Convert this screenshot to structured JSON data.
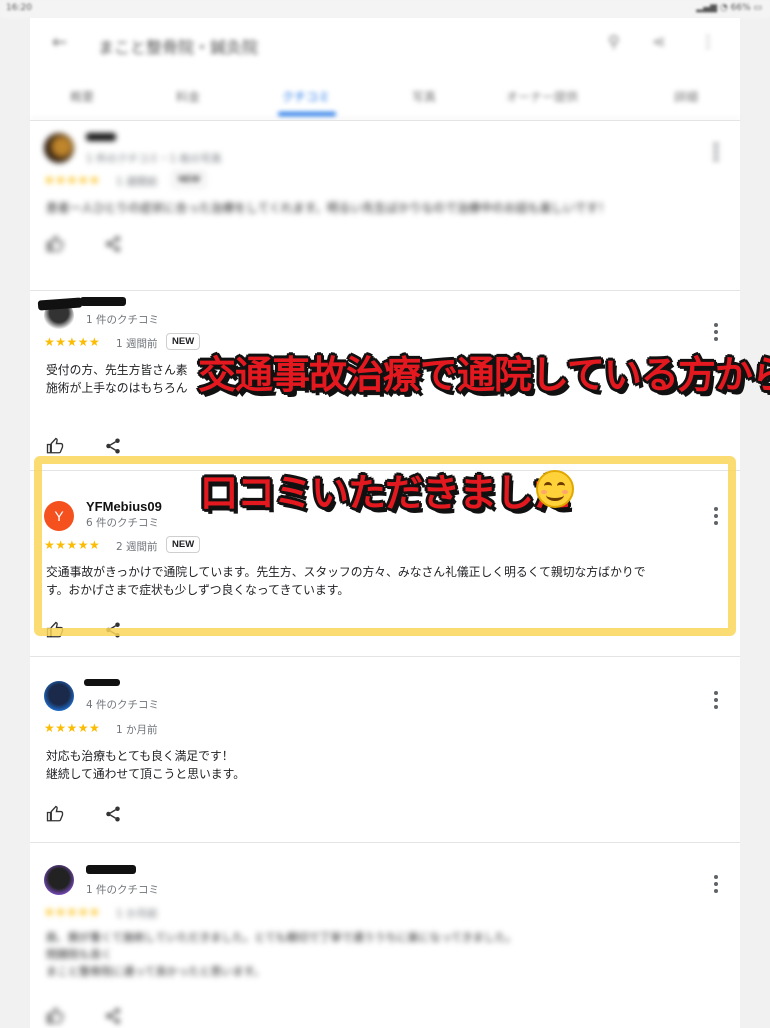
{
  "appbar": {
    "title": "まこと整骨院・鍼灸院"
  },
  "tabs": [
    "概要",
    "料金",
    "クチコミ",
    "写真",
    "オーナー提供",
    "詳細"
  ],
  "overlay": {
    "line1": "交通事故治療で通院している方から",
    "line2": "口コミいただきました"
  },
  "reviews": [
    {
      "count": "1 件のクチコミ・1 枚の写真",
      "stars": "★★★★★",
      "ago": "1 週間前",
      "badge": "NEW",
      "text": [
        "患者一人ひとりの症状に合った治療をしてくれます。明るい先生ばかりなので治療中のお話も楽しいです！"
      ]
    },
    {
      "count": "1 件のクチコミ",
      "stars": "★★★★★",
      "ago": "1 週間前",
      "badge": "NEW",
      "text": [
        "受付の方、先生方皆さん素",
        "施術が上手なのはもちろん"
      ]
    },
    {
      "avatar_letter": "Y",
      "name": "YFMebius09",
      "count": "6 件のクチコミ",
      "stars": "★★★★★",
      "ago": "2 週間前",
      "badge": "NEW",
      "text": [
        "交通事故がきっかけで通院しています。先生方、スタッフの方々、みなさん礼儀正しく明るくて親切な方ばかりで",
        "す。おかげさまで症状も少しずつ良くなってきています。"
      ]
    },
    {
      "count": "4 件のクチコミ",
      "stars": "★★★★★",
      "ago": "1 か月前",
      "text": [
        "対応も治療もとても良く満足です！",
        "継続して通わせて頂こうと思います。"
      ]
    },
    {
      "count": "1 件のクチコミ",
      "stars": "★★★★★",
      "ago": "1 か月前",
      "text": [
        "肩、腕が重くて施術していただきました。とても親切で丁寧で通ううちに楽になってきました。",
        "問題院も良く",
        "まこと整骨院に通って良かったと思います。"
      ]
    }
  ]
}
